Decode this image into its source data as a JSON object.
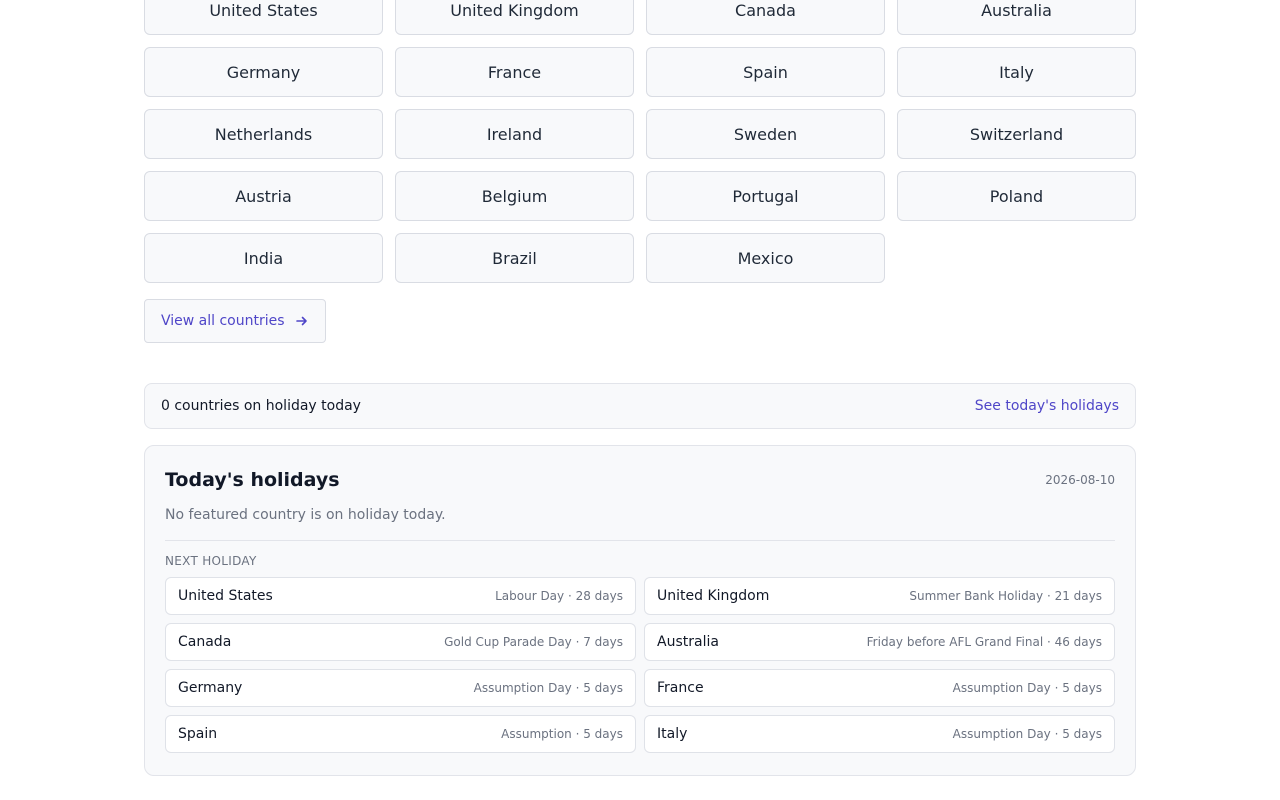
{
  "countries": [
    "United States",
    "United Kingdom",
    "Canada",
    "Australia",
    "Germany",
    "France",
    "Spain",
    "Italy",
    "Netherlands",
    "Ireland",
    "Sweden",
    "Switzerland",
    "Austria",
    "Belgium",
    "Portugal",
    "Poland",
    "India",
    "Brazil",
    "Mexico"
  ],
  "view_all_label": "View all countries",
  "today_bar": {
    "count_text": "0 countries on holiday today",
    "link_text": "See today's holidays"
  },
  "panel": {
    "title": "Today's holidays",
    "date": "2026-08-10",
    "note": "No featured country is on holiday today.",
    "section_label": "NEXT HOLIDAY",
    "next": [
      {
        "country": "United States",
        "detail": "Labour Day · 28 days"
      },
      {
        "country": "United Kingdom",
        "detail": "Summer Bank Holiday · 21 days"
      },
      {
        "country": "Canada",
        "detail": "Gold Cup Parade Day · 7 days"
      },
      {
        "country": "Australia",
        "detail": "Friday before AFL Grand Final · 46 days"
      },
      {
        "country": "Germany",
        "detail": "Assumption Day · 5 days"
      },
      {
        "country": "France",
        "detail": "Assumption Day · 5 days"
      },
      {
        "country": "Spain",
        "detail": "Assumption · 5 days"
      },
      {
        "country": "Italy",
        "detail": "Assumption Day · 5 days"
      }
    ]
  },
  "colors": {
    "accent": "#4f46c8",
    "muted_text": "#6b7280",
    "surface": "#f8f9fb",
    "border": "#d9dce3"
  },
  "icons": {
    "view_all": "arrow-right-icon"
  }
}
